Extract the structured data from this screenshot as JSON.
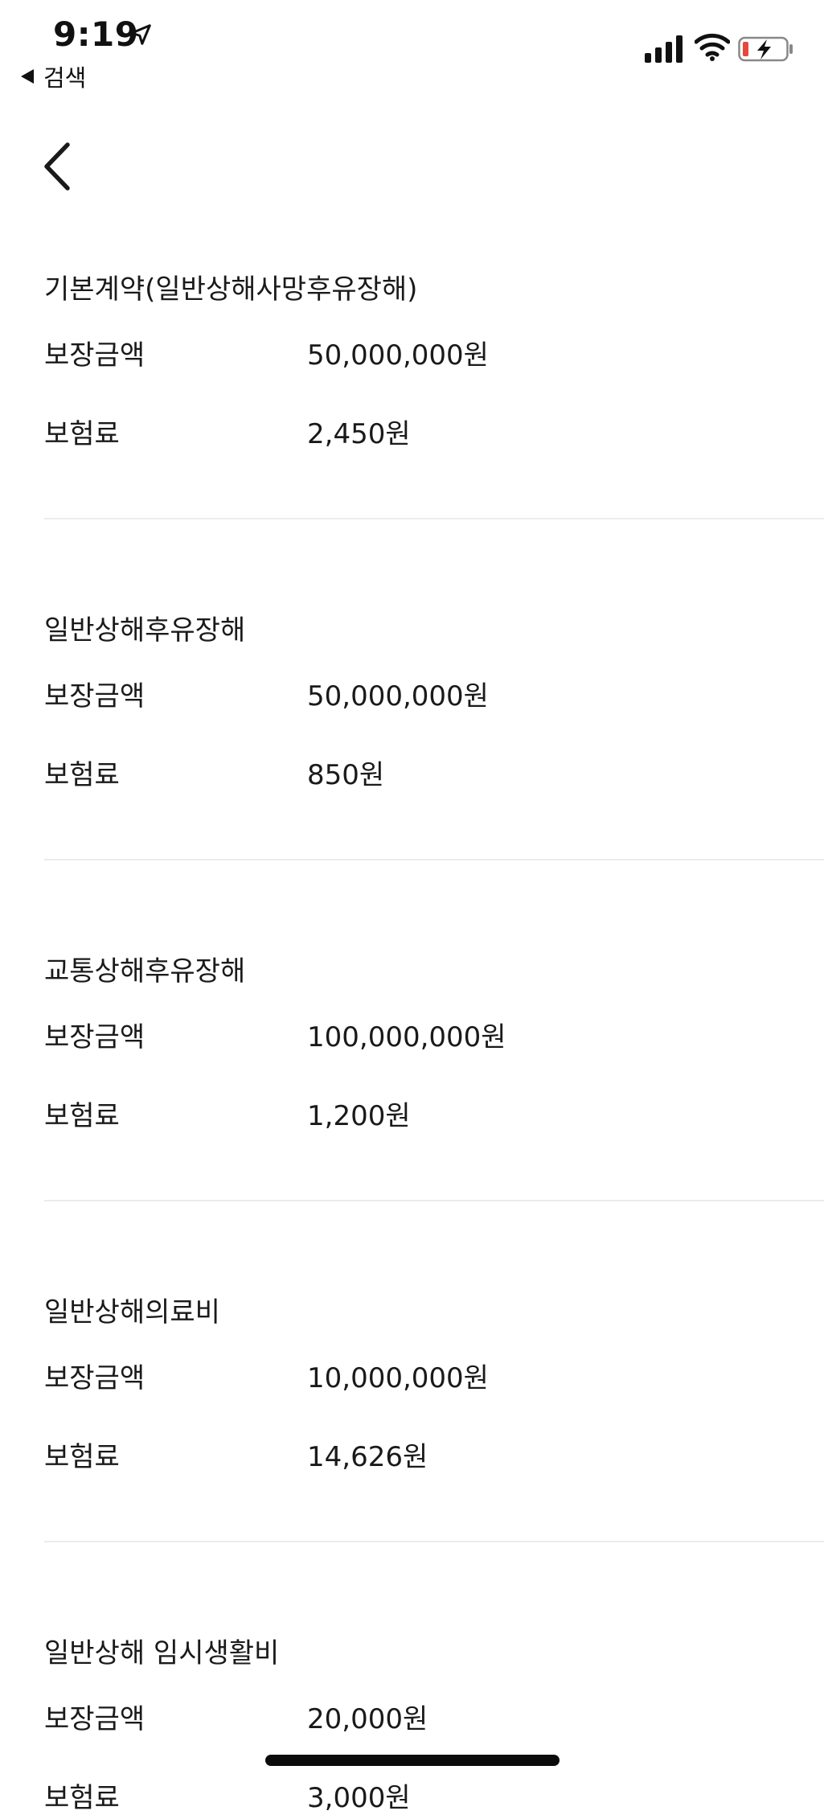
{
  "status_bar": {
    "time": "9:19",
    "back_app_label": "검색"
  },
  "sections": [
    {
      "title": "기본계약(일반상해사망후유장해)",
      "coverage_label": "보장금액",
      "coverage_value": "50,000,000원",
      "premium_label": "보험료",
      "premium_value": "2,450원"
    },
    {
      "title": "일반상해후유장해",
      "coverage_label": "보장금액",
      "coverage_value": "50,000,000원",
      "premium_label": "보험료",
      "premium_value": "850원"
    },
    {
      "title": "교통상해후유장해",
      "coverage_label": "보장금액",
      "coverage_value": "100,000,000원",
      "premium_label": "보험료",
      "premium_value": "1,200원"
    },
    {
      "title": "일반상해의료비",
      "coverage_label": "보장금액",
      "coverage_value": "10,000,000원",
      "premium_label": "보험료",
      "premium_value": "14,626원"
    },
    {
      "title": "일반상해 임시생활비",
      "coverage_label": "보장금액",
      "coverage_value": "20,000원",
      "premium_label": "보험료",
      "premium_value": "3,000원"
    }
  ],
  "colors": {
    "text": "#1a1a1a",
    "divider": "#ececec",
    "battery_low": "#e5483f"
  }
}
